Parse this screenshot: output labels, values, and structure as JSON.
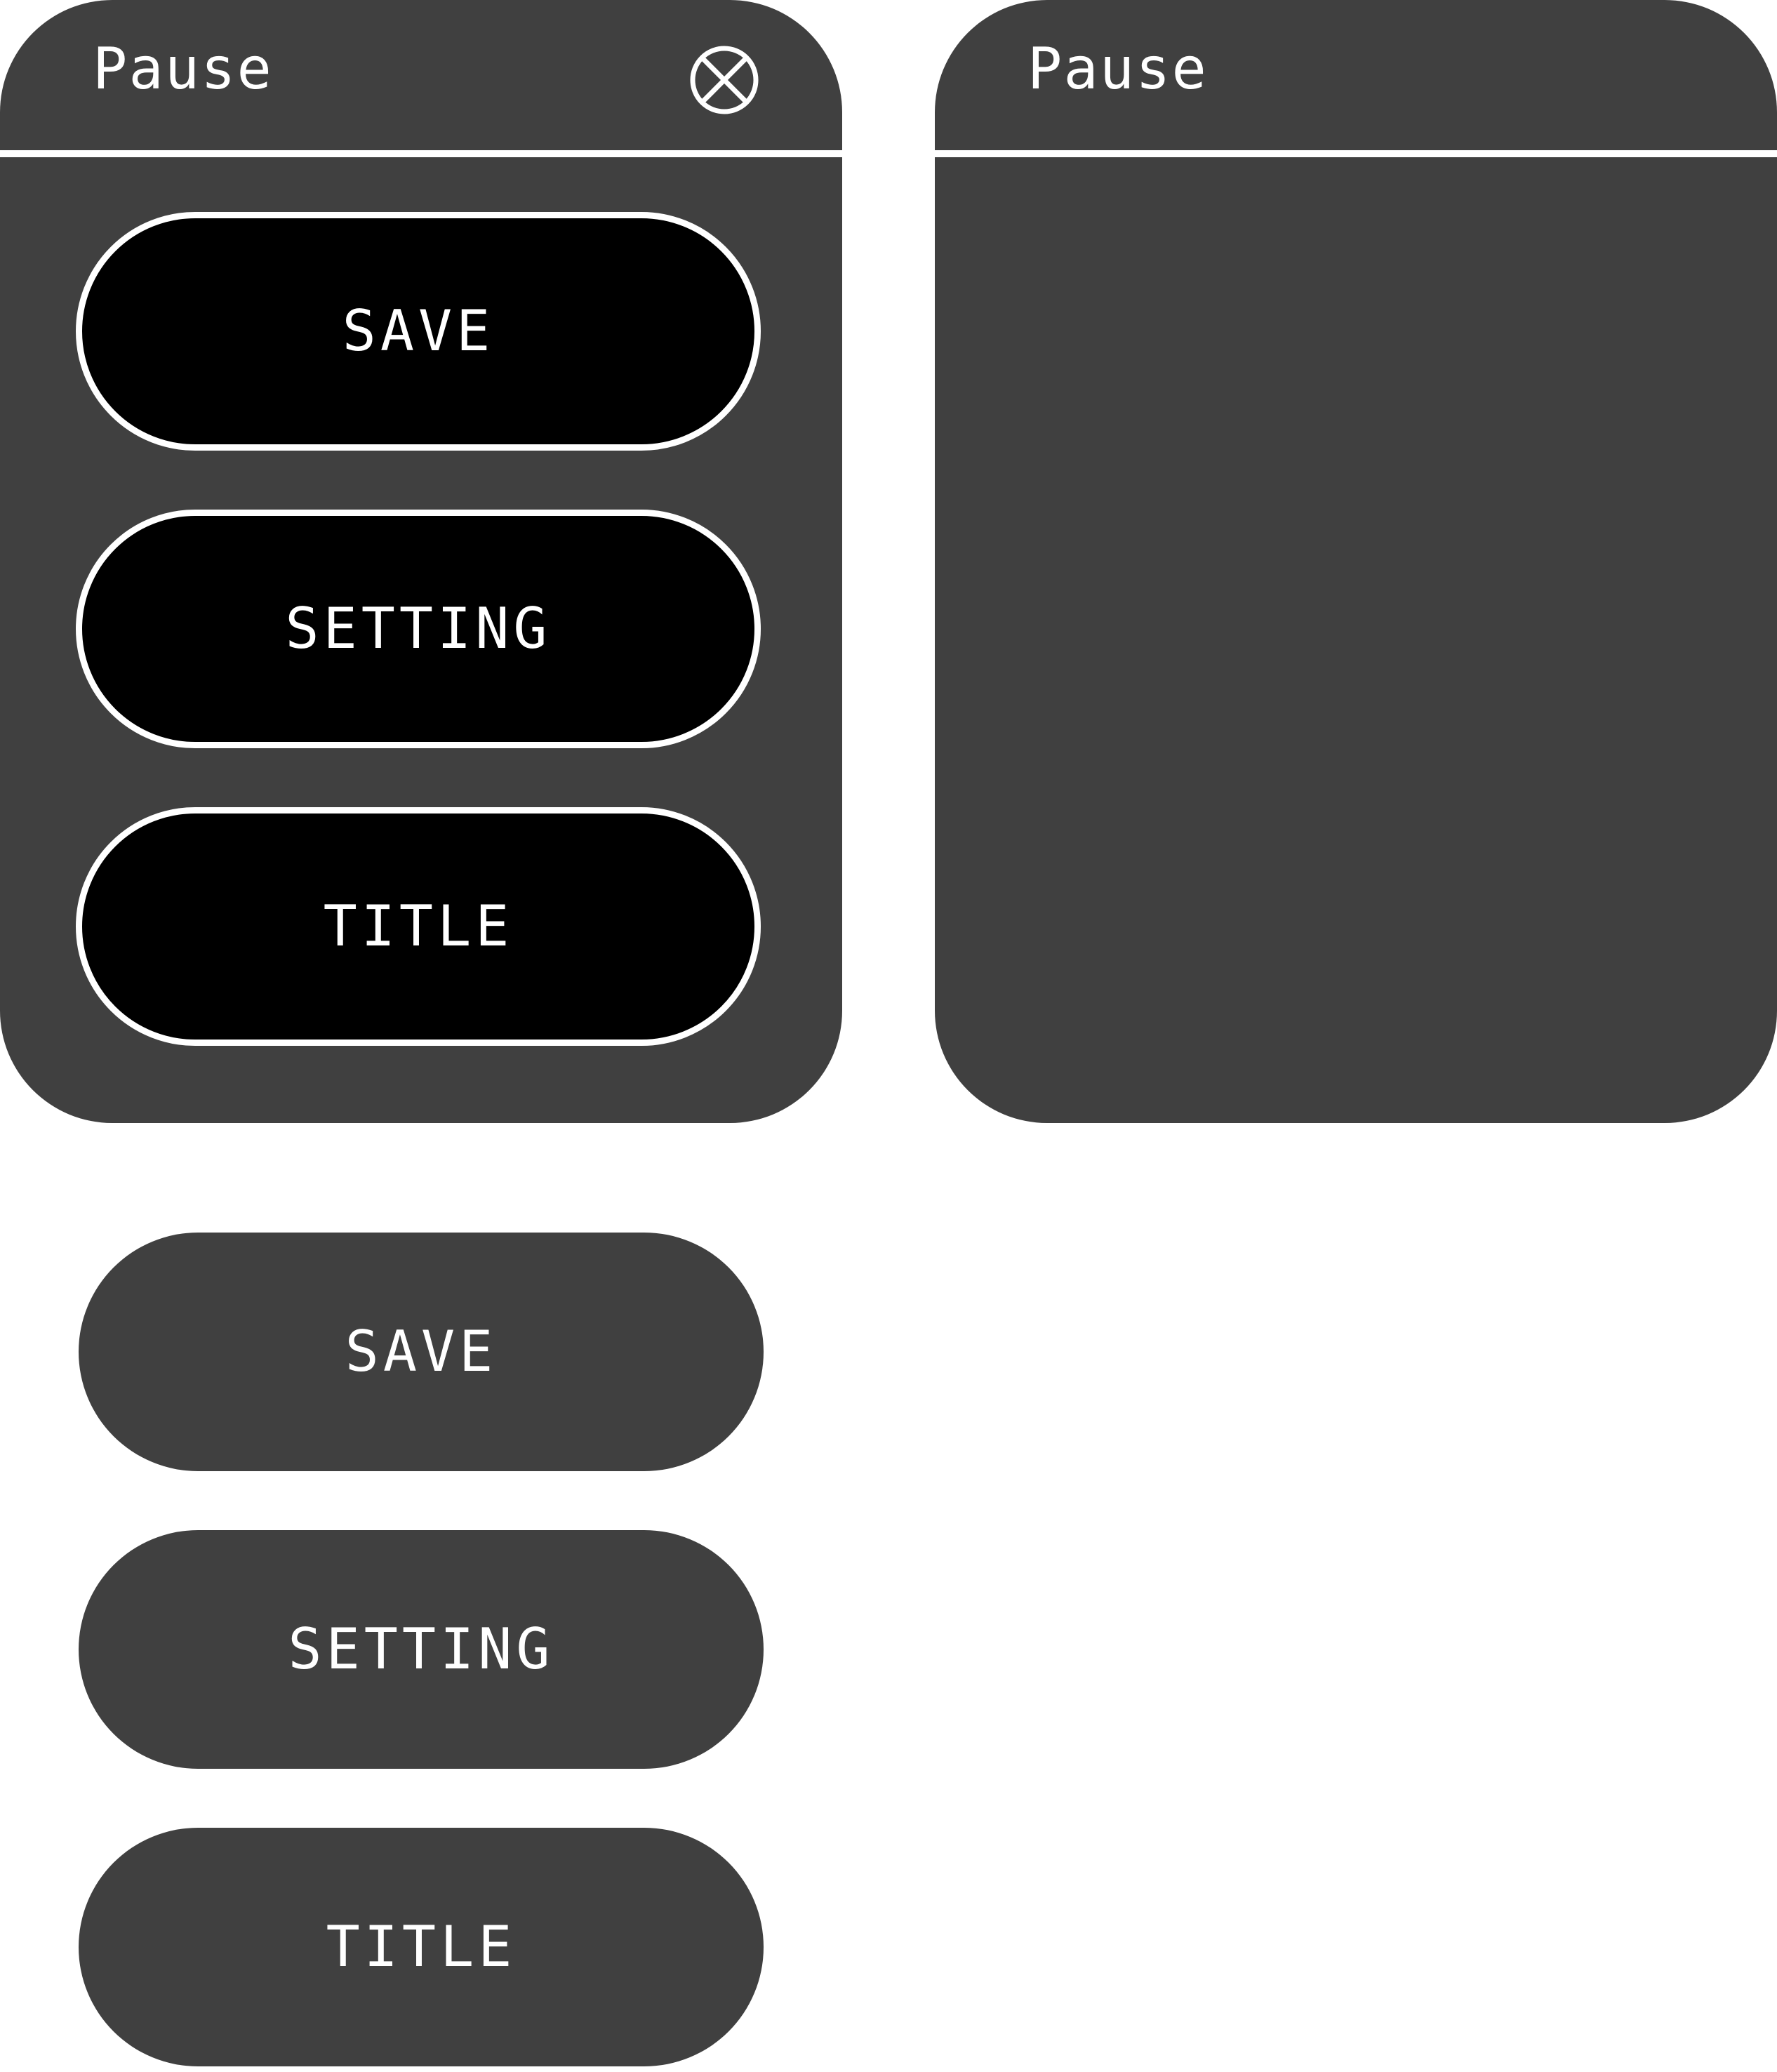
{
  "pause_menu_open": {
    "title": "Pause",
    "close_icon": "close-circle-x-icon",
    "buttons": [
      {
        "label": "SAVE"
      },
      {
        "label": "SETTING"
      },
      {
        "label": "TITLE"
      }
    ]
  },
  "pause_menu_empty": {
    "title": "Pause"
  },
  "button_states": {
    "buttons": [
      {
        "label": "SAVE"
      },
      {
        "label": "SETTING"
      },
      {
        "label": "TITLE"
      }
    ]
  },
  "colors": {
    "panel_background": "#404040",
    "button_active_background": "#000000",
    "button_idle_background": "#404040",
    "text": "#ffffff",
    "outline": "#ffffff"
  }
}
